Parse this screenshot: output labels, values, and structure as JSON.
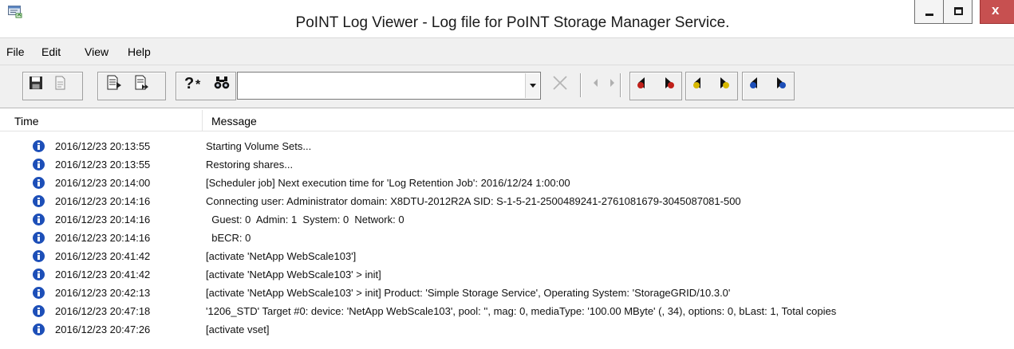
{
  "window": {
    "title": "PoINT Log Viewer - Log file for PoINT Storage Manager Service.",
    "controls": {
      "minimize": "minimize-icon",
      "maximize": "maximize-icon",
      "close": "close-icon"
    }
  },
  "menu": [
    "File",
    "Edit",
    "View",
    "Help"
  ],
  "toolbar": {
    "search_value": "",
    "icons": [
      "save-icon",
      "print-icon",
      "copy-log-icon",
      "export-log-icon",
      "help-filter-icon",
      "find-icon",
      "clear-icon",
      "previous-icon",
      "next-icon",
      "previous-error-icon",
      "next-error-icon",
      "previous-warning-icon",
      "next-warning-icon",
      "previous-info-icon",
      "next-info-icon"
    ],
    "marker_colors": {
      "error": "#c0201a",
      "warning": "#d7b800",
      "info": "#1d4fb8"
    }
  },
  "columns": {
    "time": "Time",
    "message": "Message"
  },
  "rows": [
    {
      "time": "2016/12/23 20:13:55",
      "message": "Starting Volume Sets..."
    },
    {
      "time": "2016/12/23 20:13:55",
      "message": "Restoring shares..."
    },
    {
      "time": "2016/12/23 20:14:00",
      "message": "[Scheduler job] Next execution time for 'Log Retention Job': 2016/12/24 1:00:00"
    },
    {
      "time": "2016/12/23 20:14:16",
      "message": "Connecting user: Administrator  domain: X8DTU-2012R2A SID: S-1-5-21-2500489241-2761081679-3045087081-500"
    },
    {
      "time": "2016/12/23 20:14:16",
      "message": "  Guest: 0  Admin: 1  System: 0  Network: 0"
    },
    {
      "time": "2016/12/23 20:14:16",
      "message": "  bECR: 0"
    },
    {
      "time": "2016/12/23 20:41:42",
      "message": "[activate 'NetApp WebScale103']"
    },
    {
      "time": "2016/12/23 20:41:42",
      "message": "[activate 'NetApp WebScale103' > init]"
    },
    {
      "time": "2016/12/23 20:42:13",
      "message": "[activate 'NetApp WebScale103' > init] Product: 'Simple Storage Service', Operating System: 'StorageGRID/10.3.0'"
    },
    {
      "time": "2016/12/23 20:47:18",
      "message": "'1206_STD' Target #0: device: 'NetApp WebScale103', pool: '', mag: 0, mediaType: '100.00 MByte' (, 34), options: 0, bLast: 1, Total copies"
    },
    {
      "time": "2016/12/23 20:47:26",
      "message": "[activate vset]"
    }
  ]
}
